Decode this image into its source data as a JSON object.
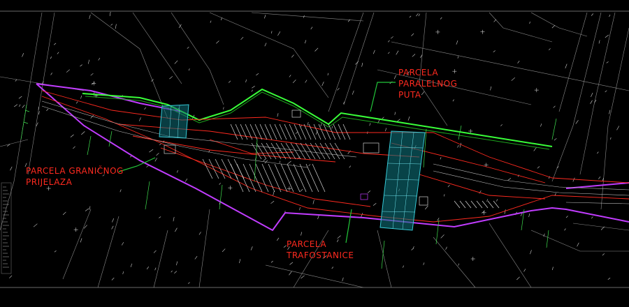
{
  "colors": {
    "background": "#000000",
    "parcel_labels": "#ff2a1f",
    "leaders": "#22c63a",
    "parallel_road": "#39ff39",
    "boundary": "#c13cff",
    "substation": "#35c9d6",
    "cadastre": "#8c8c8c"
  },
  "labels": {
    "parallel_road": [
      "PARCELA",
      "PARALELNOG",
      "PUTA"
    ],
    "crossing": [
      "PARCELA GRANIČNOG",
      "PRIJELAZA"
    ],
    "substation": [
      "PARCELA",
      "TRAFOSTANICE"
    ]
  }
}
